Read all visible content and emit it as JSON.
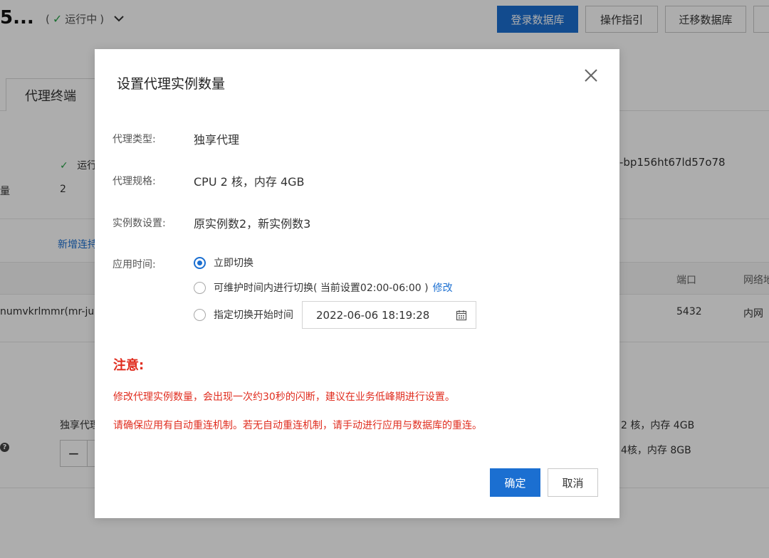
{
  "background": {
    "title": "5...",
    "status": "运行中",
    "buttons": [
      "登录数据库",
      "操作指引",
      "迁移数据库"
    ],
    "tab": "代理终端",
    "status_row": "运行",
    "count_label": "量",
    "count_value": "2",
    "instance_id": "-bp156ht67ld57o78",
    "add_link": "新增连持",
    "col_port": "端口",
    "col_network": "网络地",
    "row_name": "numvkrlmmr(mr-jub",
    "row_port": "5432",
    "row_network": "内网",
    "proxy_label": "独享代理",
    "spec_1": "2 核，内存 4GB",
    "spec_2": "4核，内存 8GB",
    "stepper_minus": "−"
  },
  "dialog": {
    "title": "设置代理实例数量",
    "proxy_type_label": "代理类型:",
    "proxy_type_value": "独享代理",
    "proxy_spec_label": "代理规格:",
    "proxy_spec_value": "CPU 2 核，内存 4GB",
    "instance_count_label": "实例数设置:",
    "instance_count_value": "原实例数2，新实例数3",
    "apply_time_label": "应用时间:",
    "options": {
      "immediate": "立即切换",
      "maintenance": "可维护时间内进行切换( 当前设置02:00-06:00 )",
      "maintenance_link": "修改",
      "scheduled": "指定切换开始时间"
    },
    "selected_option": "immediate",
    "datetime_value": "2022-06-06 18:19:28",
    "note_title": "注意:",
    "note_lines": [
      "修改代理实例数量，会出现一次约30秒的闪断，建议在业务低峰期进行设置。",
      "请确保应用有自动重连机制。若无自动重连机制，请手动进行应用与数据库的重连。"
    ],
    "ok_label": "确定",
    "cancel_label": "取消"
  },
  "colors": {
    "primary": "#1b6fd1",
    "warning_red": "#e02d1f",
    "success_green": "#27a348",
    "overlay": "rgba(0,0,0,0.32)"
  },
  "icons": [
    "check-icon",
    "chevron-down-icon",
    "close-icon",
    "calendar-icon",
    "help-icon"
  ]
}
